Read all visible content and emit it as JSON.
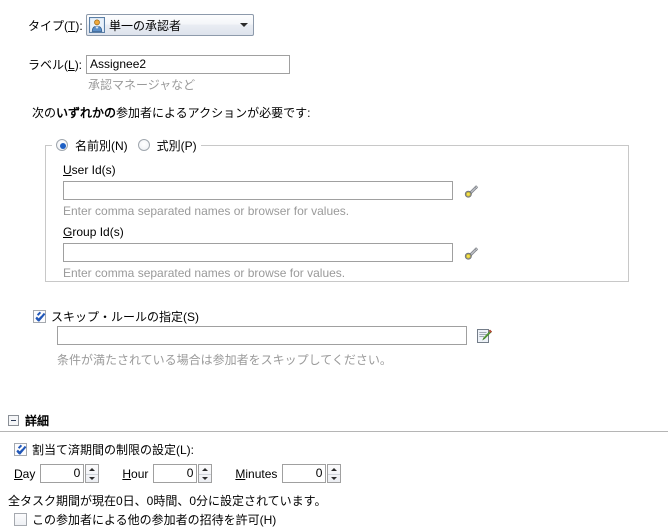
{
  "type_row": {
    "label": "タイプ(T):",
    "label_plain": "タイプ",
    "accesskey": "T",
    "selected_value": "単一の承認者",
    "icon": "single-approver-user-icon",
    "dropdown_icon": "chevron-down-icon",
    "options": [
      "単一の承認者"
    ]
  },
  "label_row": {
    "label": "ラベル(L):",
    "accesskey": "L",
    "value": "Assignee2",
    "placeholder": "承認マネージャなど",
    "hint": "承認マネージャなど"
  },
  "instruction": {
    "prefix": "次の",
    "bold": "いずれかの",
    "suffix": "参加者によるアクションが必要です:"
  },
  "participant_group": {
    "radios": [
      {
        "label": "名前別(N)",
        "accesskey": "N",
        "selected": true,
        "name": "radio-by-name"
      },
      {
        "label": "式別(P)",
        "accesskey": "P",
        "selected": false,
        "name": "radio-by-expression"
      }
    ],
    "fields": [
      {
        "label": "User Id(s)",
        "label_pre": "U",
        "label_post": "ser Id(s)",
        "value": "",
        "placeholder": "",
        "hint": "Enter comma separated names or browser for values.",
        "browse_icon": "flashlight-browse-icon"
      },
      {
        "label": "Group Id(s)",
        "label_pre": "G",
        "label_post": "roup Id(s)",
        "value": "",
        "placeholder": "",
        "hint": "Enter comma separated names or browse for values.",
        "browse_icon": "flashlight-browse-icon"
      }
    ]
  },
  "skip_rule": {
    "checkbox_label": "スキップ・ルールの指定(S)",
    "accesskey": "S",
    "checked": true,
    "value": "",
    "placeholder": "",
    "hint": "条件が満たされている場合は参加者をスキップしてください。",
    "edit_icon": "edit-expression-icon"
  },
  "details": {
    "expander_icon": "collapse-minus-icon",
    "title": "詳細",
    "expanded": true,
    "duration_checkbox": {
      "label": "割当て済期間の制限の設定(L):",
      "accesskey": "L",
      "checked": true
    },
    "duration_fields": [
      {
        "label": "Day",
        "label_pre": "D",
        "label_post": "ay",
        "value": "0",
        "name": "day-spinner"
      },
      {
        "label": "Hour",
        "label_pre": "H",
        "label_post": "our",
        "value": "0",
        "name": "hour-spinner"
      },
      {
        "label": "Minutes",
        "label_pre": "M",
        "label_post": "inutes",
        "value": "0",
        "name": "minutes-spinner"
      }
    ],
    "summary": "全タスク期間が現在0日、0時間、0分に設定されています。",
    "invite_checkbox": {
      "label": "この参加者による他の参加者の招待を許可(H)",
      "accesskey": "H",
      "checked": false
    }
  },
  "colors": {
    "accent_blue": "#1d5fc4",
    "hint_gray": "#9a9a9a",
    "border_gray": "#a0a0a0",
    "group_border": "#c8c8c8",
    "rule_gray": "#b5b5b5"
  }
}
